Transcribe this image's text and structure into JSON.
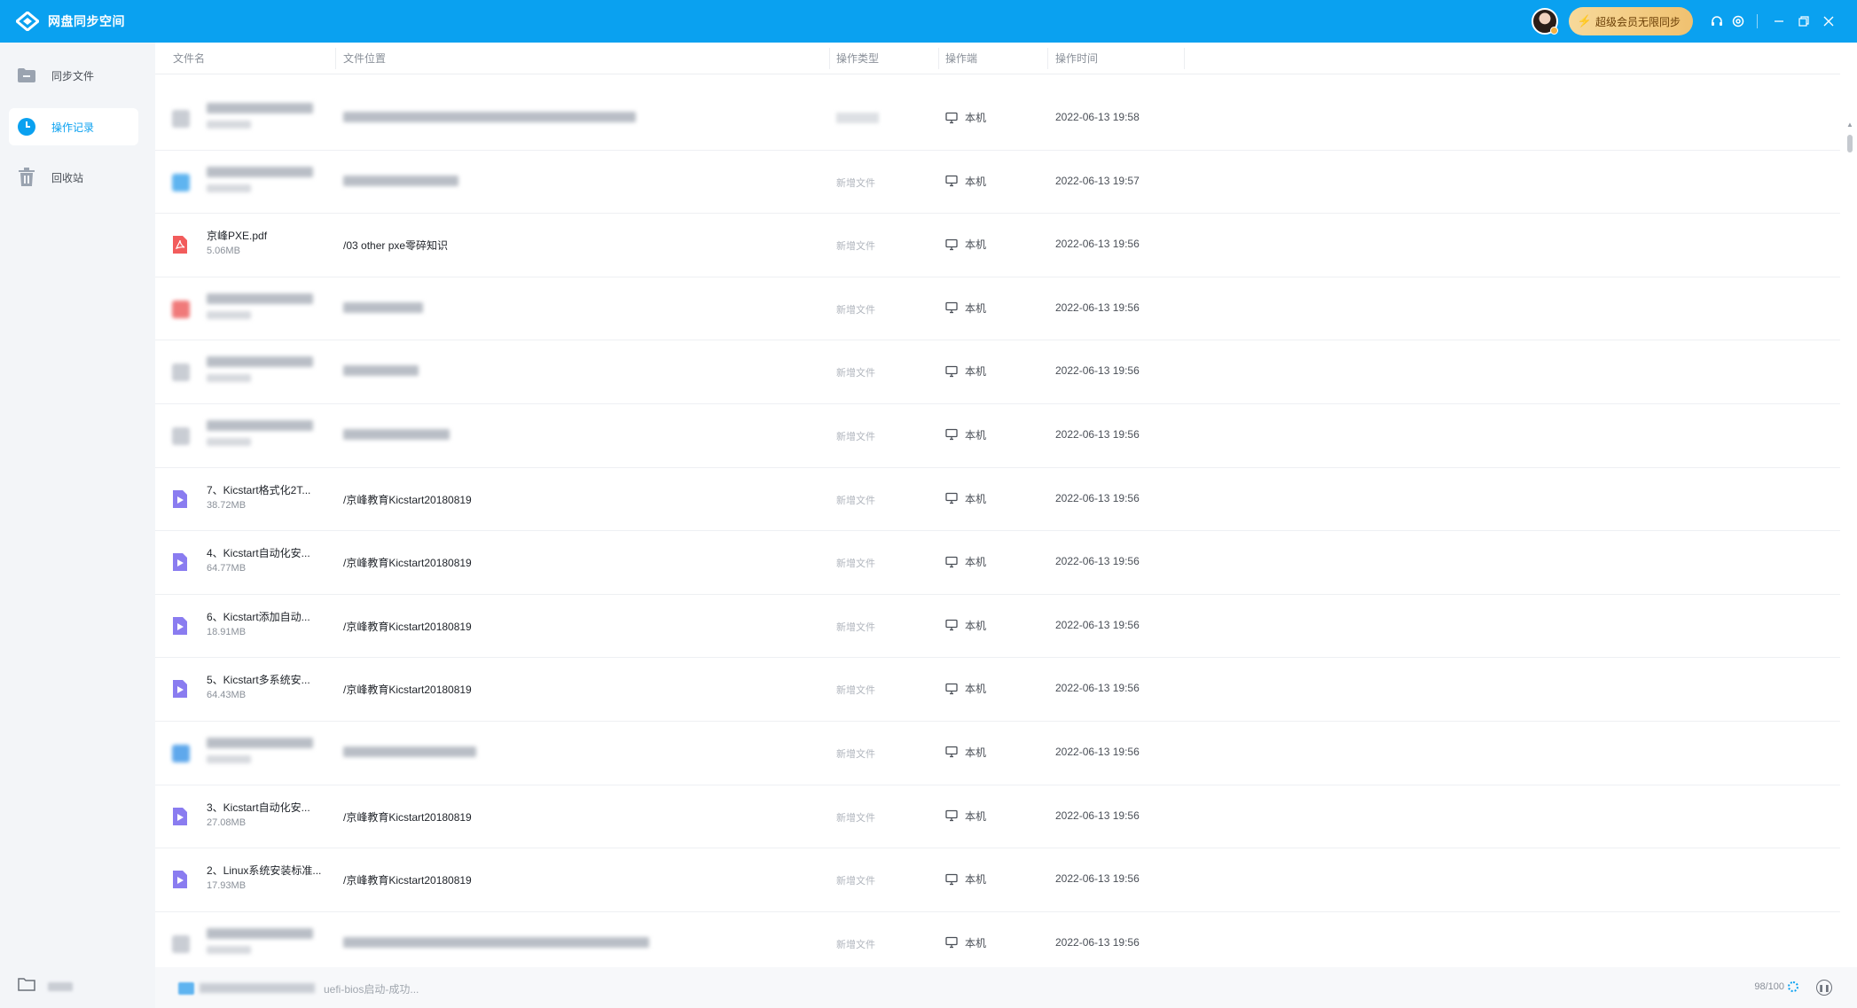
{
  "app": {
    "title": "网盘同步空间"
  },
  "header": {
    "vip_label": "超级会员无限同步",
    "icons": [
      "headset-icon",
      "settings-icon",
      "minimize-icon",
      "restore-icon",
      "close-icon"
    ]
  },
  "sidebar": {
    "items": [
      {
        "label": "同步文件",
        "icon": "folder-icon",
        "active": false
      },
      {
        "label": "操作记录",
        "icon": "clock-icon",
        "active": true
      },
      {
        "label": "回收站",
        "icon": "trash-icon",
        "active": false
      }
    ]
  },
  "table": {
    "columns": [
      "文件名",
      "文件位置",
      "操作类型",
      "操作端",
      "操作时间"
    ],
    "rows": [
      {
        "name": "",
        "size": "",
        "path": "",
        "type": "",
        "device": "本机",
        "time": "2022-06-13 19:58",
        "icon": "file-icon",
        "blur": true
      },
      {
        "name": "",
        "size": "",
        "path": "",
        "type": "新增文件",
        "device": "本机",
        "time": "2022-06-13 19:57",
        "icon": "plus-icon",
        "blur": true
      },
      {
        "name": "京峰PXE.pdf",
        "size": "5.06MB",
        "path": "/03 other pxe零碎知识",
        "type": "新增文件",
        "device": "本机",
        "time": "2022-06-13 19:56",
        "icon": "pdf-icon",
        "blur": false
      },
      {
        "name": "",
        "size": "",
        "path": "",
        "type": "新增文件",
        "device": "本机",
        "time": "2022-06-13 19:56",
        "icon": "red-file-icon",
        "blur": true
      },
      {
        "name": "",
        "size": "",
        "path": "",
        "type": "新增文件",
        "device": "本机",
        "time": "2022-06-13 19:56",
        "icon": "file-icon",
        "blur": true
      },
      {
        "name": "",
        "size": "",
        "path": "",
        "type": "新增文件",
        "device": "本机",
        "time": "2022-06-13 19:56",
        "icon": "file-icon",
        "blur": true
      },
      {
        "name": "7、Kicstart格式化2T...",
        "size": "38.72MB",
        "path": "/京峰教育Kicstart20180819",
        "type": "新增文件",
        "device": "本机",
        "time": "2022-06-13 19:56",
        "icon": "video-icon",
        "blur": false
      },
      {
        "name": "4、Kicstart自动化安...",
        "size": "64.77MB",
        "path": "/京峰教育Kicstart20180819",
        "type": "新增文件",
        "device": "本机",
        "time": "2022-06-13 19:56",
        "icon": "video-icon",
        "blur": false
      },
      {
        "name": "6、Kicstart添加自动...",
        "size": "18.91MB",
        "path": "/京峰教育Kicstart20180819",
        "type": "新增文件",
        "device": "本机",
        "time": "2022-06-13 19:56",
        "icon": "video-icon",
        "blur": false
      },
      {
        "name": "5、Kicstart多系统安...",
        "size": "64.43MB",
        "path": "/京峰教育Kicstart20180819",
        "type": "新增文件",
        "device": "本机",
        "time": "2022-06-13 19:56",
        "icon": "video-icon",
        "blur": false
      },
      {
        "name": "",
        "size": "",
        "path": "",
        "type": "新增文件",
        "device": "本机",
        "time": "2022-06-13 19:56",
        "icon": "blue-file-icon",
        "blur": true
      },
      {
        "name": "3、Kicstart自动化安...",
        "size": "27.08MB",
        "path": "/京峰教育Kicstart20180819",
        "type": "新增文件",
        "device": "本机",
        "time": "2022-06-13 19:56",
        "icon": "video-icon",
        "blur": false
      },
      {
        "name": "2、Linux系统安装标准...",
        "size": "17.93MB",
        "path": "/京峰教育Kicstart20180819",
        "type": "新增文件",
        "device": "本机",
        "time": "2022-06-13 19:56",
        "icon": "video-icon",
        "blur": false
      },
      {
        "name": "",
        "size": "",
        "path": "",
        "type": "新增文件",
        "device": "本机",
        "time": "2022-06-13 19:56",
        "icon": "file-icon",
        "blur": true
      }
    ]
  },
  "status": {
    "message": "uefi-bios启动-成功...",
    "count": "98/100"
  },
  "colors": {
    "accent": "#0aa1f0",
    "vip_gold": "#f0c170",
    "pdf_red": "#f25c5c",
    "video_purple": "#8a7cf0"
  }
}
